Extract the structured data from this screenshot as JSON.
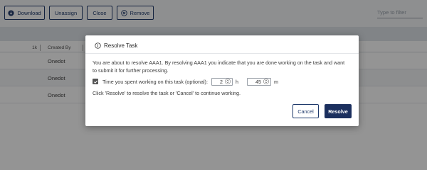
{
  "toolbar": {
    "download_label": "Download",
    "unassign_label": "Unassign",
    "close_label": "Close",
    "remove_label": "Remove",
    "filter_placeholder": "Type to filter"
  },
  "table": {
    "headers": {
      "number": "1k",
      "created_by": "Created By"
    },
    "rows": [
      {
        "created_by": "Onedot"
      },
      {
        "created_by": "Onedot"
      },
      {
        "created_by": "Onedot"
      }
    ]
  },
  "modal": {
    "title": "Resolve Task",
    "description": "You are about to resolve AAA1. By resolving AAA1 you indicate that you are done working on the task and want to submit it for further processing.",
    "time_label": "Time you spent working on this task (optional):",
    "time_checked": true,
    "hours_value": "2",
    "hours_unit": "h",
    "minutes_value": "45",
    "minutes_unit": "m",
    "instruction": "Click 'Resolve' to resolve the task or 'Cancel' to continue working.",
    "cancel_label": "Cancel",
    "resolve_label": "Resolve"
  },
  "colors": {
    "accent": "#1b2f5e",
    "outline": "#1f3a6b"
  }
}
